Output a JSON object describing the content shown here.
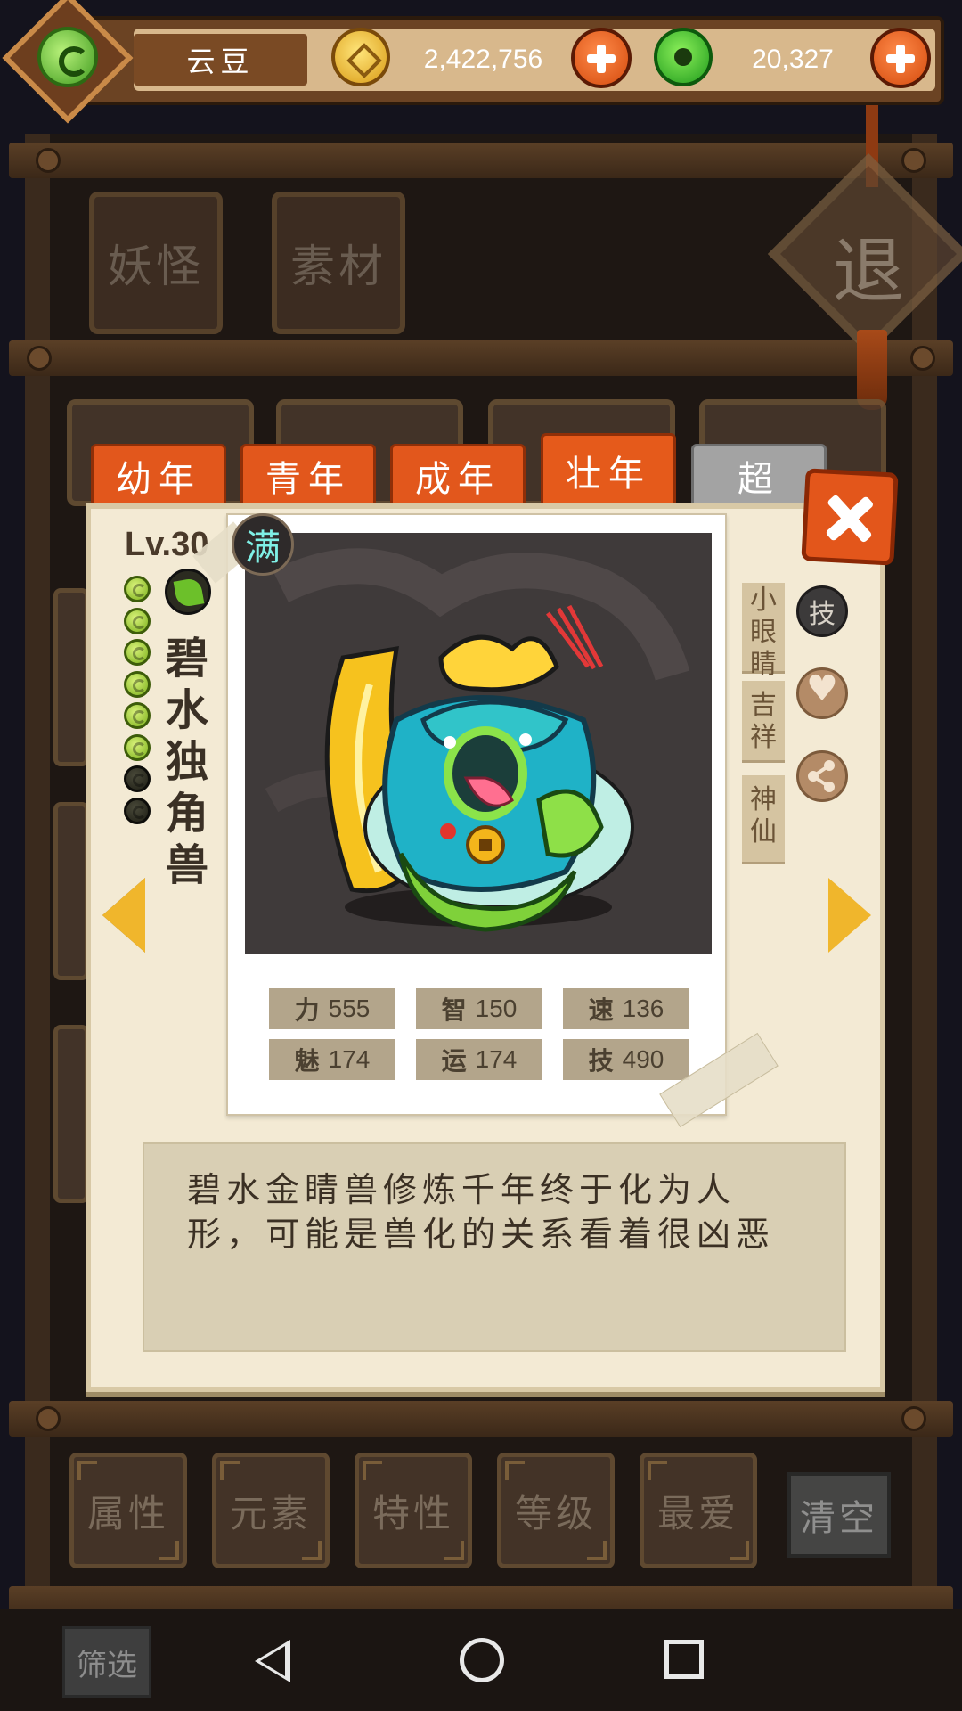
{
  "currency": {
    "player_name": "云豆",
    "coins": "2,422,756",
    "jade": "20,327"
  },
  "categories": [
    "妖怪",
    "素材"
  ],
  "retreat_label": "退",
  "age_tabs": [
    "幼年",
    "青年",
    "成年",
    "壮年",
    "超"
  ],
  "monster": {
    "level": "Lv.30",
    "max_badge": "满",
    "name": "碧水独角兽",
    "gems_total": 8,
    "gems_filled": 6,
    "element_icon": "leaf-icon",
    "tags": [
      "小眼睛",
      "吉祥",
      "神仙"
    ],
    "skill_label": "技",
    "stats": [
      {
        "label": "力",
        "value": "555"
      },
      {
        "label": "智",
        "value": "150"
      },
      {
        "label": "速",
        "value": "136"
      },
      {
        "label": "魅",
        "value": "174"
      },
      {
        "label": "运",
        "value": "174"
      },
      {
        "label": "技",
        "value": "490"
      }
    ],
    "description": "碧水金睛兽修炼千年终于化为人形，可能是兽化的关系看着很凶恶"
  },
  "filters": [
    "属性",
    "元素",
    "特性",
    "等级",
    "最爱"
  ],
  "clear_label": "清空",
  "screen_label": "筛选",
  "colors": {
    "accent_orange": "#e2571c",
    "gold": "#f0b62c",
    "panel": "#f3ead4",
    "wood": "#6b4323"
  }
}
